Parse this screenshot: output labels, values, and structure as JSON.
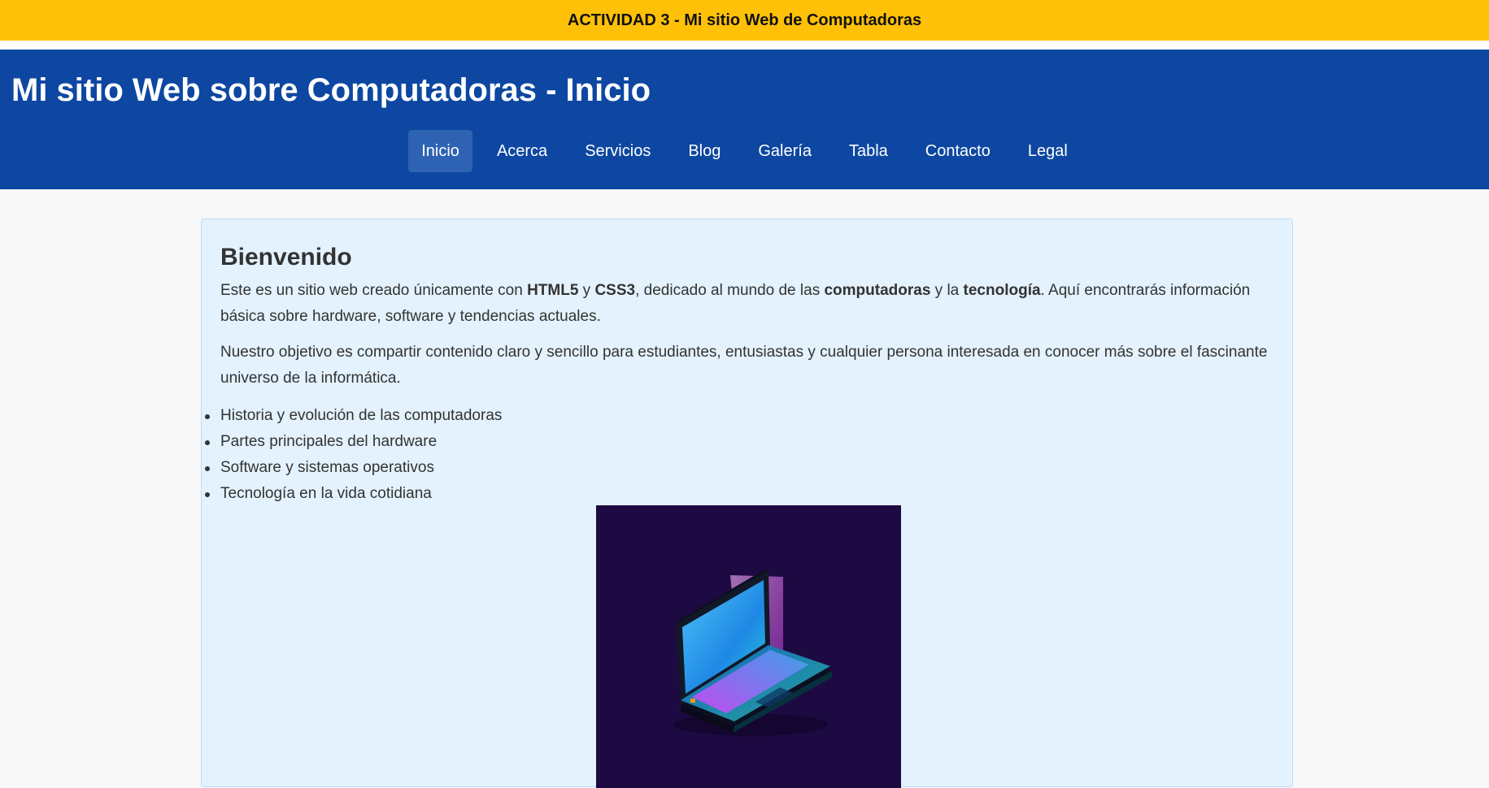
{
  "activity_banner": "ACTIVIDAD 3 - Mi sitio Web de Computadoras",
  "header": {
    "title": "Mi sitio Web sobre Computadoras - Inicio"
  },
  "nav": {
    "items": [
      {
        "label": "Inicio",
        "active": true
      },
      {
        "label": "Acerca"
      },
      {
        "label": "Servicios"
      },
      {
        "label": "Blog"
      },
      {
        "label": "Galería"
      },
      {
        "label": "Tabla"
      },
      {
        "label": "Contacto"
      },
      {
        "label": "Legal"
      }
    ]
  },
  "main": {
    "heading": "Bienvenido",
    "intro": {
      "t1": "Este es un sitio web creado únicamente con ",
      "b1": "HTML5",
      "t2": " y ",
      "b2": "CSS3",
      "t3": ", dedicado al mundo de las ",
      "b3": "computadoras",
      "t4": " y la ",
      "b4": "tecnología",
      "t5": ". Aquí encontrarás información básica sobre hardware, software y tendencias actuales."
    },
    "objective": "Nuestro objetivo es compartir contenido claro y sencillo para estudiantes, entusiastas y cualquier persona interesada en conocer más sobre el fascinante universo de la informática.",
    "features": [
      "Historia y evolución de las computadoras",
      "Partes principales del hardware",
      "Software y sistemas operativos",
      "Tecnología en la vida cotidiana"
    ],
    "image_icon": "laptop-illustration"
  },
  "colors": {
    "banner": "#ffc107",
    "header": "#0d47a1",
    "nav_active": "#2e63b3",
    "card_bg": "#e3f2fd",
    "image_bg": "#1e0a42"
  }
}
